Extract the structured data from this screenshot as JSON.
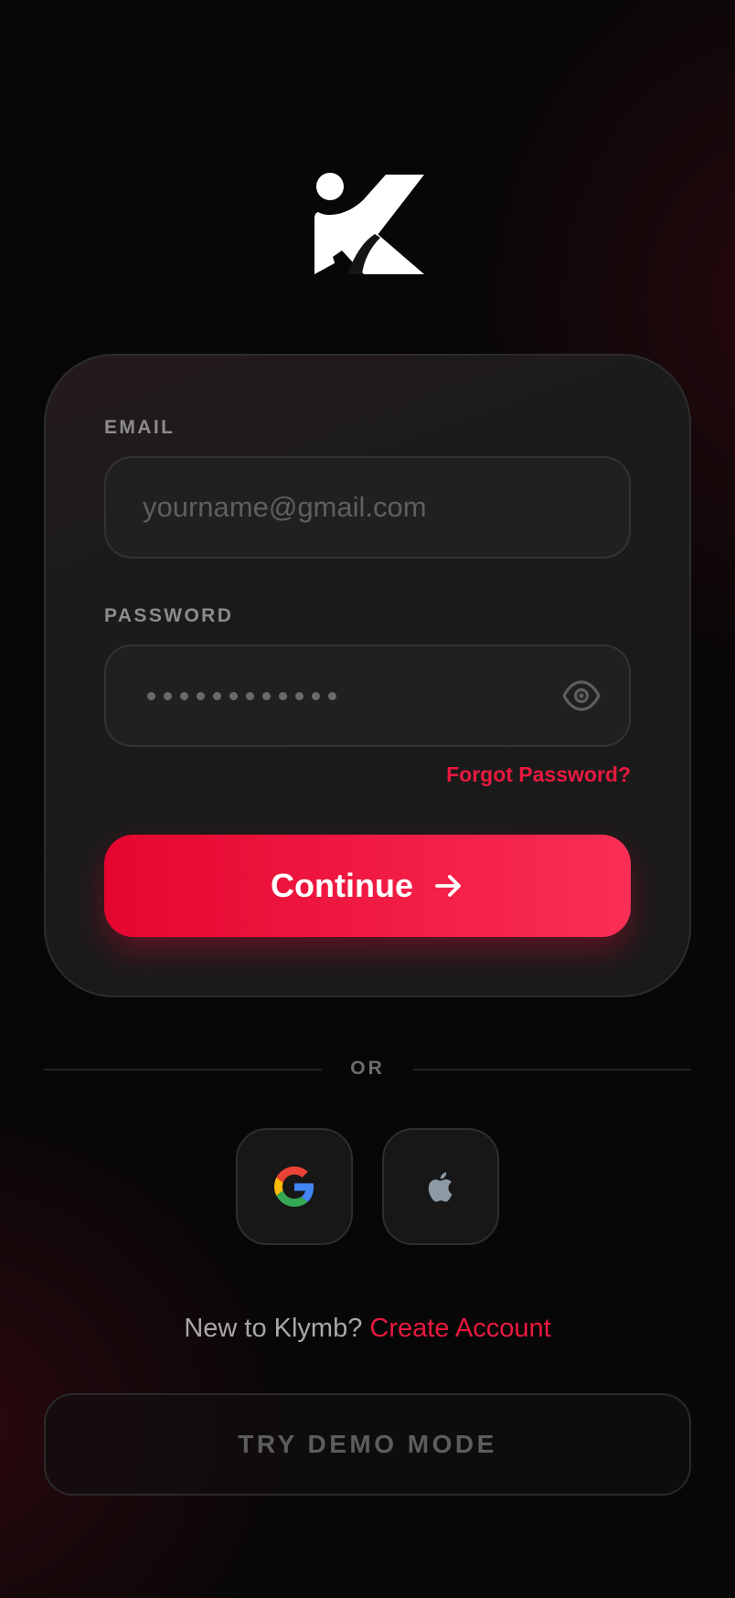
{
  "app": {
    "name": "Klymb",
    "accent": "#e8193f",
    "background": "#070707"
  },
  "logo": {
    "icon": "klymb-k-logo"
  },
  "login_form": {
    "email": {
      "label": "EMAIL",
      "placeholder": "yourname@gmail.com",
      "value": ""
    },
    "password": {
      "label": "PASSWORD",
      "masked_length": 12,
      "visibility_icon": "eye-icon"
    },
    "forgot_password": "Forgot Password?",
    "continue_label": "Continue",
    "continue_icon": "arrow-right-icon"
  },
  "divider": {
    "label": "OR"
  },
  "social_login": [
    {
      "provider": "Google",
      "icon": "google-icon"
    },
    {
      "provider": "Apple",
      "icon": "apple-icon"
    }
  ],
  "signup": {
    "prompt": "New to Klymb?",
    "link": "Create Account"
  },
  "demo": {
    "label": "TRY DEMO MODE"
  }
}
